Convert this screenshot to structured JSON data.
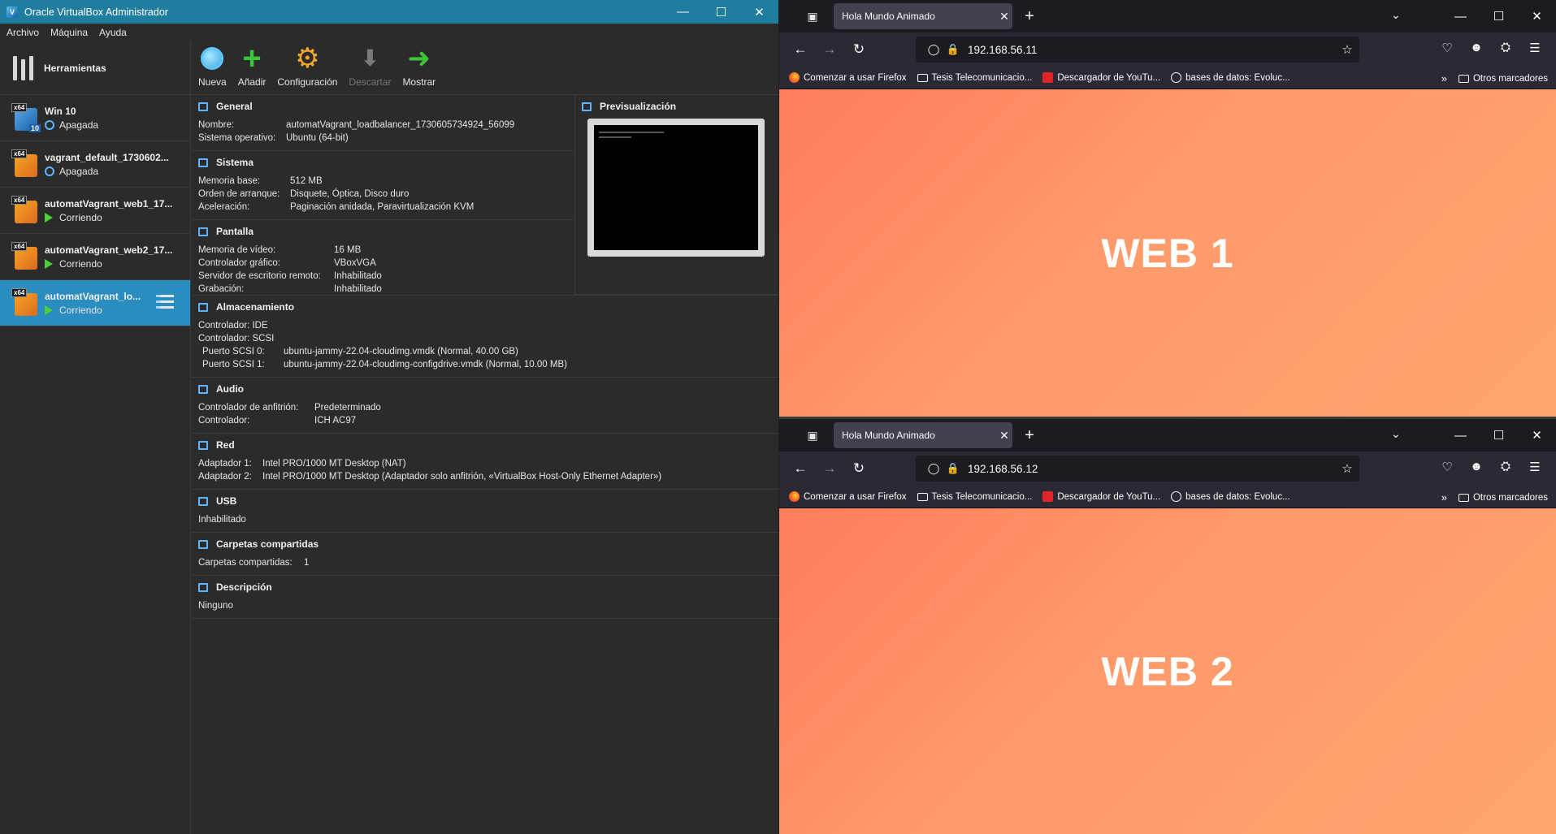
{
  "vbox": {
    "title": "Oracle VirtualBox Administrador",
    "menu": [
      "Archivo",
      "Máquina",
      "Ayuda"
    ],
    "tools_label": "Herramientas",
    "vms": [
      {
        "name": "Win 10",
        "state": "Apagada",
        "os_badge": "x64",
        "os_sub": "10"
      },
      {
        "name": "vagrant_default_1730602...",
        "state": "Apagada",
        "os_badge": "x64"
      },
      {
        "name": "automatVagrant_web1_17...",
        "state": "Corriendo",
        "os_badge": "x64"
      },
      {
        "name": "automatVagrant_web2_17...",
        "state": "Corriendo",
        "os_badge": "x64"
      },
      {
        "name": "automatVagrant_lo...",
        "state": "Corriendo",
        "os_badge": "x64"
      }
    ],
    "toolbar": {
      "new": "Nueva",
      "add": "Añadir",
      "settings": "Configuración",
      "discard": "Descartar",
      "show": "Mostrar"
    },
    "general": {
      "title": "General",
      "name_k": "Nombre:",
      "name_v": "automatVagrant_loadbalancer_1730605734924_56099",
      "os_k": "Sistema operativo:",
      "os_v": "Ubuntu (64-bit)"
    },
    "system": {
      "title": "Sistema",
      "mem_k": "Memoria base:",
      "mem_v": "512 MB",
      "boot_k": "Orden de arranque:",
      "boot_v": "Disquete, Óptica, Disco duro",
      "accel_k": "Aceleración:",
      "accel_v": "Paginación anidada, Paravirtualización KVM"
    },
    "display": {
      "title": "Pantalla",
      "vmem_k": "Memoria de vídeo:",
      "vmem_v": "16 MB",
      "gfx_k": "Controlador gráfico:",
      "gfx_v": "VBoxVGA",
      "rdp_k": "Servidor de escritorio remoto:",
      "rdp_v": "Inhabilitado",
      "rec_k": "Grabación:",
      "rec_v": "Inhabilitado"
    },
    "preview": {
      "title": "Previsualización"
    },
    "storage": {
      "title": "Almacenamiento",
      "ide": "Controlador: IDE",
      "scsi": "Controlador: SCSI",
      "port0_k": "Puerto SCSI 0:",
      "port0_v": "ubuntu-jammy-22.04-cloudimg.vmdk (Normal, 40.00 GB)",
      "port1_k": "Puerto SCSI 1:",
      "port1_v": "ubuntu-jammy-22.04-cloudimg-configdrive.vmdk (Normal, 10.00 MB)"
    },
    "audio": {
      "title": "Audio",
      "host_k": "Controlador de anfitrión:",
      "host_v": "Predeterminado",
      "ctrl_k": "Controlador:",
      "ctrl_v": "ICH AC97"
    },
    "network": {
      "title": "Red",
      "a1_k": "Adaptador 1:",
      "a1_v": "Intel PRO/1000 MT Desktop (NAT)",
      "a2_k": "Adaptador 2:",
      "a2_v": "Intel PRO/1000 MT Desktop (Adaptador solo anfitrión, «VirtualBox Host-Only Ethernet Adapter»)"
    },
    "usb": {
      "title": "USB",
      "value": "Inhabilitado"
    },
    "shared": {
      "title": "Carpetas compartidas",
      "k": "Carpetas compartidas:",
      "v": "1"
    },
    "description": {
      "title": "Descripción",
      "value": "Ninguno"
    }
  },
  "firefox": {
    "bookmarks": [
      {
        "label": "Comenzar a usar Firefox",
        "icon": "firefox-icon"
      },
      {
        "label": "Tesis Telecomunicacio...",
        "icon": "folder-icon"
      },
      {
        "label": "Descargador de YouTu...",
        "icon": "youtube-icon"
      },
      {
        "label": "bases de datos: Evoluc...",
        "icon": "globe-icon"
      }
    ],
    "other_bookmarks": "Otros marcadores",
    "windows": [
      {
        "tab_title": "Hola Mundo Animado",
        "url": "192.168.56.11",
        "heading": "WEB 1"
      },
      {
        "tab_title": "Hola Mundo Animado",
        "url": "192.168.56.12",
        "heading": "WEB 2"
      }
    ]
  },
  "colors": {
    "vbox_titlebar": "#1f7ea0",
    "vbox_selected": "#2b8cbf",
    "ff_chrome": "#1c1b22",
    "page_gradient_start": "#ff7d5c",
    "page_gradient_end": "#ffa56f"
  }
}
